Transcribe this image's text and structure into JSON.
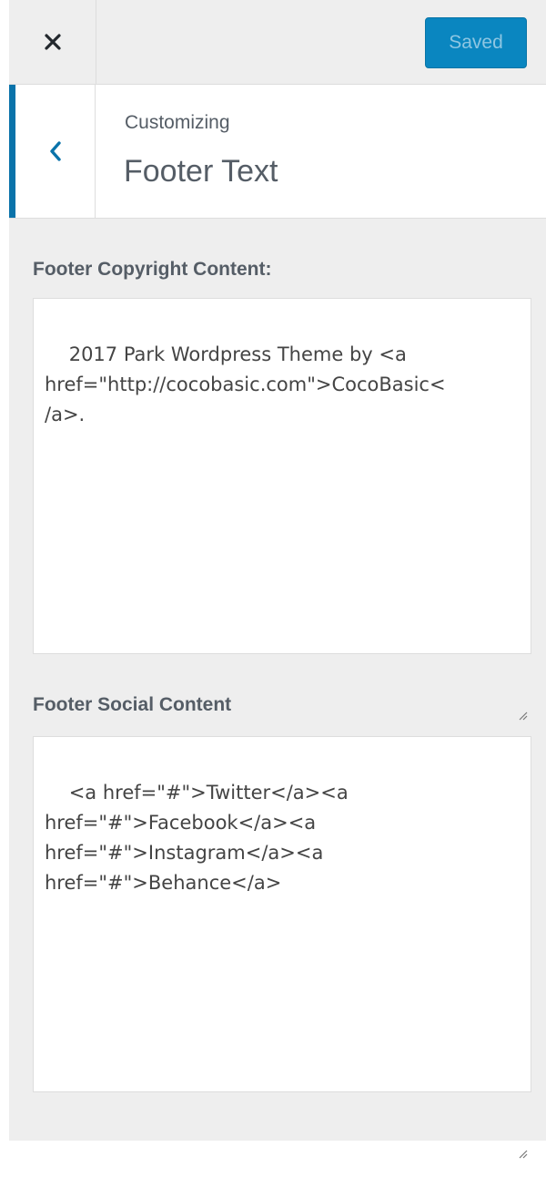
{
  "header": {
    "close_icon": "close-icon",
    "save_label": "Saved"
  },
  "section": {
    "back_icon": "chevron-left-icon",
    "breadcrumb": "Customizing",
    "title": "Footer Text"
  },
  "controls": [
    {
      "label": "Footer Copyright Content:",
      "value": "2017 Park Wordpress Theme by <a\nhref=\"http://cocobasic.com\">CocoBasic<\n/a>."
    },
    {
      "label": "Footer Social Content",
      "value": "<a href=\"#\">Twitter</a><a\nhref=\"#\">Facebook</a><a\nhref=\"#\">Instagram</a><a\nhref=\"#\">Behance</a>"
    }
  ],
  "colors": {
    "accent": "#0a73aa",
    "save_button": "#0a86c0",
    "panel_background": "#eeeeee"
  }
}
